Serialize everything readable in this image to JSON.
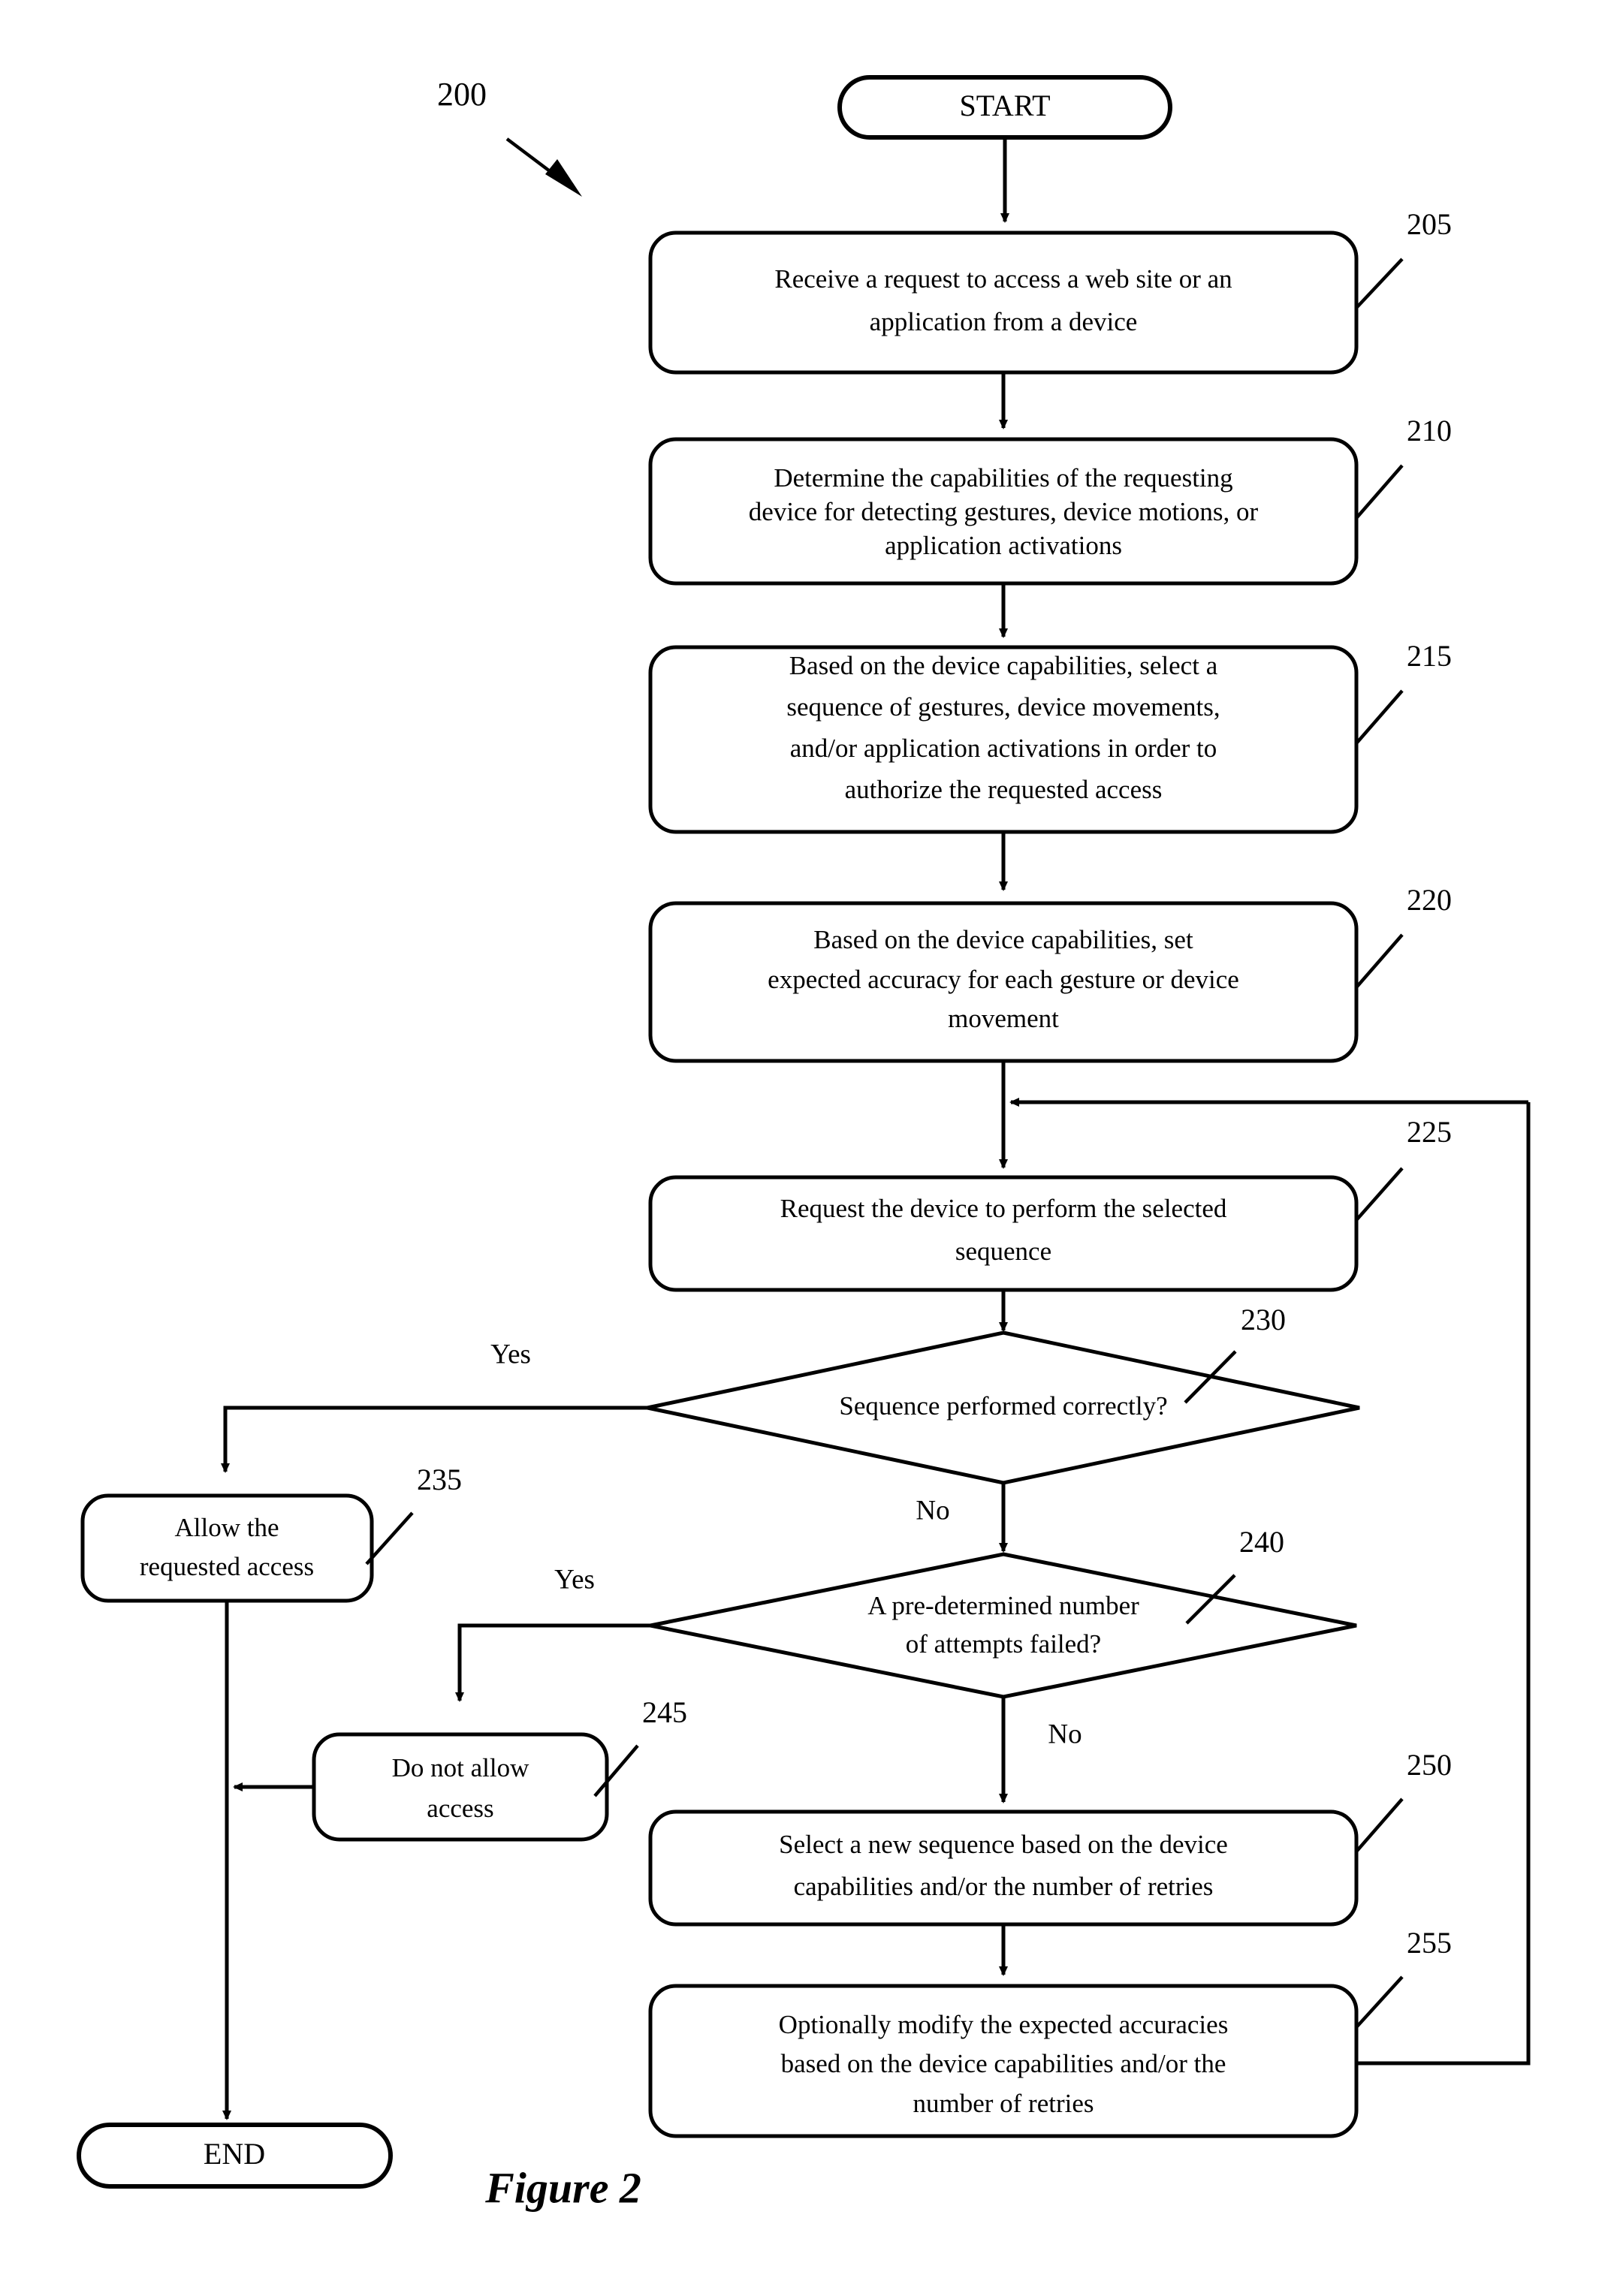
{
  "figure": {
    "caption": "Figure 2",
    "diagram_reference": "200"
  },
  "terminators": {
    "start": "START",
    "end": "END"
  },
  "branch_labels": {
    "d230_yes": "Yes",
    "d230_no": "No",
    "d240_yes": "Yes",
    "d240_no": "No"
  },
  "nodes": [
    {
      "ref": "205",
      "type": "process",
      "lines": [
        "Receive a request to access a web site or an",
        "application from a device"
      ]
    },
    {
      "ref": "210",
      "type": "process",
      "lines": [
        "Determine the capabilities of the requesting",
        "device for detecting gestures, device motions, or",
        "application activations"
      ]
    },
    {
      "ref": "215",
      "type": "process",
      "lines": [
        "Based on the device capabilities, select a",
        "sequence of gestures,  device movements,",
        "and/or application activations in order to",
        "authorize the requested access"
      ]
    },
    {
      "ref": "220",
      "type": "process",
      "lines": [
        "Based on the device capabilities, set",
        "expected accuracy for each gesture or device",
        "movement"
      ]
    },
    {
      "ref": "225",
      "type": "process",
      "lines": [
        "Request the device to perform the selected",
        "sequence"
      ]
    },
    {
      "ref": "230",
      "type": "decision",
      "lines": [
        "Sequence performed correctly?"
      ]
    },
    {
      "ref": "235",
      "type": "process",
      "lines": [
        "Allow the",
        "requested access"
      ]
    },
    {
      "ref": "240",
      "type": "decision",
      "lines": [
        "A pre-determined number",
        "of attempts failed?"
      ]
    },
    {
      "ref": "245",
      "type": "process",
      "lines": [
        "Do not allow",
        "access"
      ]
    },
    {
      "ref": "250",
      "type": "process",
      "lines": [
        "Select a new sequence based on the device",
        "capabilities and/or the number of retries"
      ]
    },
    {
      "ref": "255",
      "type": "process",
      "lines": [
        "Optionally modify the expected accuracies",
        "based on the device capabilities and/or the",
        "number of retries"
      ]
    }
  ],
  "colors": {
    "stroke": "#000000",
    "fill": "#ffffff"
  }
}
